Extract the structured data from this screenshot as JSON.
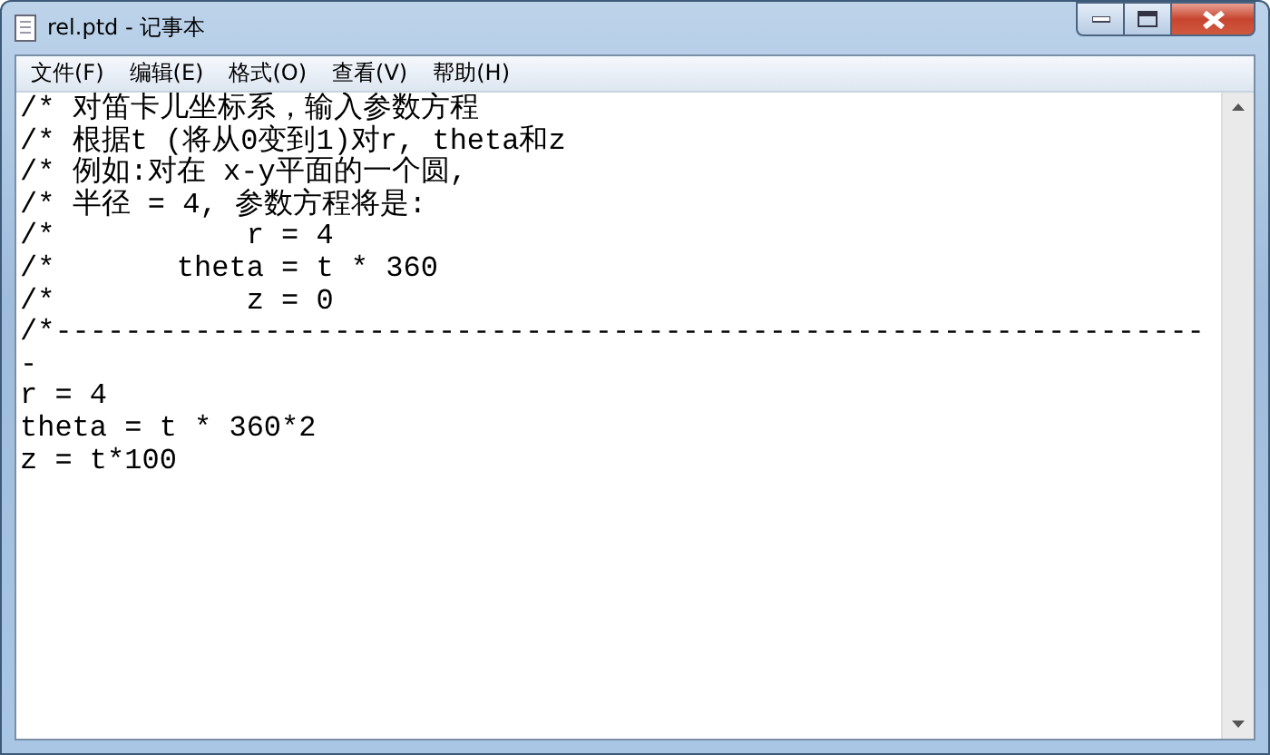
{
  "window": {
    "title": "rel.ptd - 记事本"
  },
  "menu": [
    "文件(F)",
    "编辑(E)",
    "格式(O)",
    "查看(V)",
    "帮助(H)"
  ],
  "lines": [
    "/* 对笛卡儿坐标系，输入参数方程",
    "/* 根据t (将从0变到1)对r, theta和z",
    "/* 例如:对在 x-y平面的一个圆,",
    "/* 半径 = 4, 参数方程将是:",
    "/*           r = 4",
    "/*       theta = t * 360",
    "/*           z = 0",
    "/*------------------------------------------------------------------",
    "-",
    "r = 4",
    "theta = t * 360*2",
    "z = t*100"
  ]
}
